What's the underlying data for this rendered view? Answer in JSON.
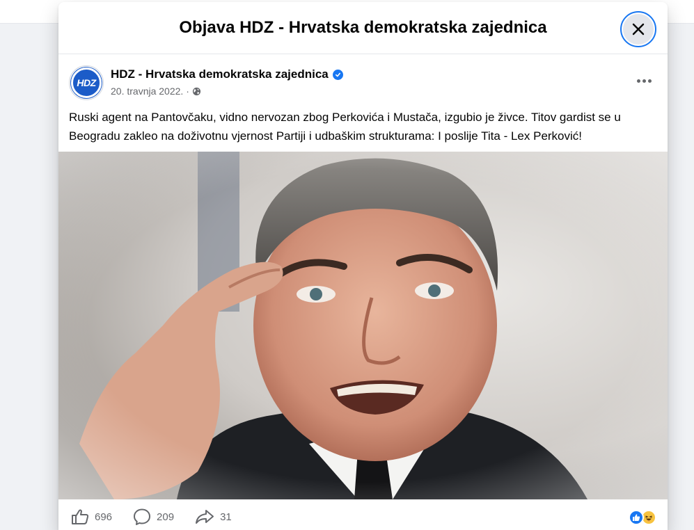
{
  "modal": {
    "title": "Objava HDZ - Hrvatska demokratska zajednica",
    "close_icon": "close-icon"
  },
  "post": {
    "avatar_text": "HDZ",
    "author": "HDZ - Hrvatska demokratska zajednica",
    "verified_icon": "verified-badge-icon",
    "date": "20. travnja 2022.",
    "separator": "·",
    "privacy_icon": "globe-icon",
    "text": "Ruski agent na Pantovčaku, vidno nervozan zbog Perkovića i Mustača, izgubio je živce. Titov gardist se u Beogradu zakleo na doživotnu vjernost Partiji i udbaškim strukturama: I poslije Tita - Lex Perković!",
    "image_icon": "post-photo"
  },
  "footer": {
    "likes": "696",
    "comments": "209",
    "shares": "31",
    "reactions": [
      "like-icon",
      "haha-icon"
    ]
  },
  "colors": {
    "accent": "#1877f2",
    "text": "#050505",
    "muted": "#65676b"
  }
}
